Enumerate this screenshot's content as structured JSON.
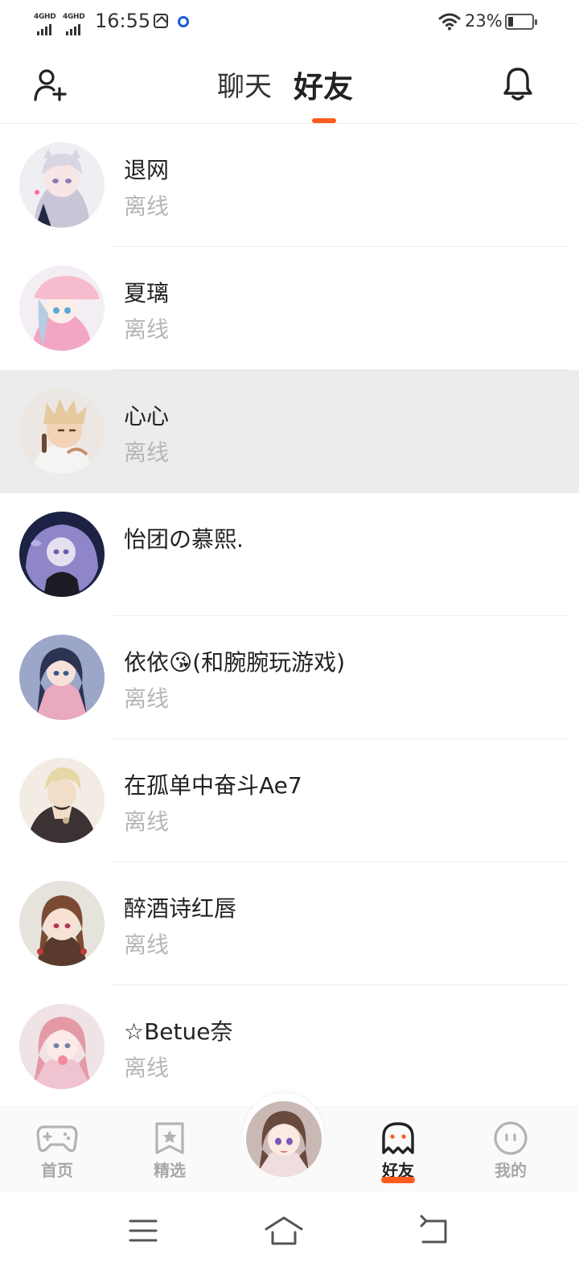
{
  "status_bar": {
    "sim1": "4GHD",
    "sim2": "4GHD",
    "time": "16:55",
    "battery_pct": "23%",
    "battery_level": 0.23
  },
  "header": {
    "tab_chat": "聊天",
    "tab_friends": "好友",
    "active_tab": "好友",
    "icons": {
      "left": "add-friend-icon",
      "right": "bell-icon"
    }
  },
  "friends": [
    {
      "name": "退网",
      "status": "离线"
    },
    {
      "name": "夏璃",
      "status": "离线"
    },
    {
      "name": "心心",
      "status": "离线"
    },
    {
      "name": "怡团の慕熙.",
      "status": ""
    },
    {
      "name": "依依😘(和腕腕玩游戏)",
      "status": "离线"
    },
    {
      "name": "在孤单中奋斗Ae7",
      "status": "离线"
    },
    {
      "name": "醉酒诗红唇",
      "status": "离线"
    },
    {
      "name": "☆Betue奈",
      "status": "离线"
    }
  ],
  "bottom_nav": {
    "home": "首页",
    "featured": "精选",
    "friends": "好友",
    "mine": "我的",
    "active": "好友"
  },
  "colors": {
    "accent": "#ff5a1f",
    "offline_text": "#b7b7b7",
    "highlight_row": "#ececec"
  }
}
